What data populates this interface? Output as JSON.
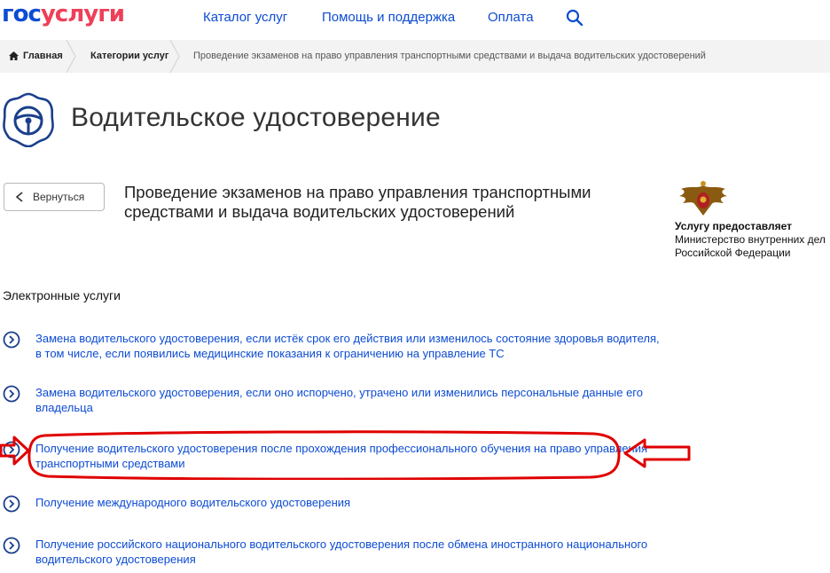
{
  "header": {
    "logo_part1": "гос",
    "logo_part2": "услуги",
    "nav": [
      "Каталог услуг",
      "Помощь и поддержка",
      "Оплата"
    ]
  },
  "breadcrumb": {
    "items": [
      "Главная",
      "Категории услуг",
      "Проведение экзаменов на право управления транспортными средствами и выдача водительских удостоверений"
    ]
  },
  "page": {
    "title": "Водительское удостоверение",
    "back_label": "Вернуться",
    "service_title": "Проведение экзаменов на право управления транспортными средствами и выдача водительских удостоверений"
  },
  "provider": {
    "label": "Услугу предоставляет",
    "line1": "Министерство внутренних дел",
    "line2": "Российской Федерации"
  },
  "services": {
    "section_title": "Электронные услуги",
    "items": [
      "Замена водительского удостоверения, если истёк срок его действия или изменилось состояние здоровья водителя, в том числе, если появились медицинские показания к ограничению на управление ТС",
      "Замена водительского удостоверения, если оно испорчено, утрачено или изменились персональные данные его владельца",
      "Получение водительского удостоверения после прохождения профессионального обучения на право управления транспортными средствами",
      "Получение международного водительского удостоверения",
      "Получение российского национального водительского удостоверения после обмена иностранного национального водительского удостоверения"
    ]
  },
  "colors": {
    "brand_blue": "#0d4cd3",
    "brand_red": "#ee3f58",
    "annotation_red": "#e00000"
  }
}
